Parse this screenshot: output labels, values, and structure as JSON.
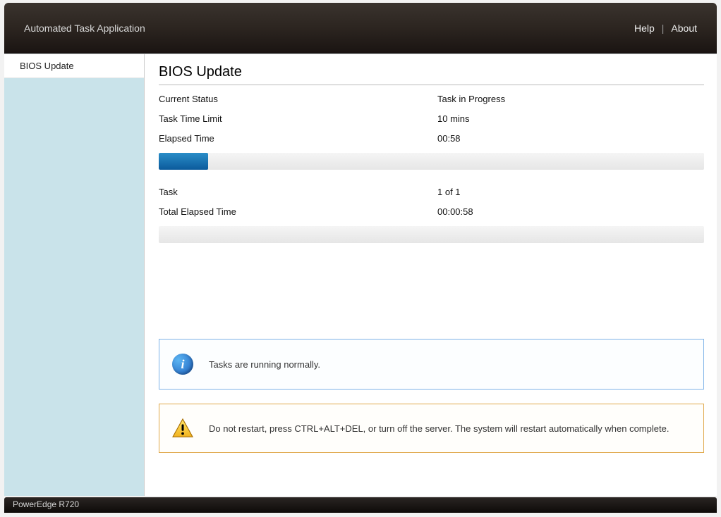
{
  "header": {
    "title": "Automated Task Application",
    "links": {
      "help": "Help",
      "about": "About"
    }
  },
  "sidebar": {
    "items": [
      {
        "label": "BIOS Update"
      }
    ]
  },
  "main": {
    "page_title": "BIOS Update",
    "status_rows": [
      {
        "label": "Current Status",
        "value": "Task in Progress"
      },
      {
        "label": "Task Time Limit",
        "value": "10 mins"
      },
      {
        "label": "Elapsed Time",
        "value": "00:58"
      }
    ],
    "progress1_percent": 9,
    "task_rows": [
      {
        "label": "Task",
        "value": "1 of 1"
      },
      {
        "label": "Total Elapsed Time",
        "value": "00:00:58"
      }
    ],
    "progress2_percent": 0,
    "alerts": {
      "info": "Tasks are running normally.",
      "warn": "Do not restart, press CTRL+ALT+DEL, or turn off the server.  The system will restart automatically when complete."
    }
  },
  "footer": {
    "model": "PowerEdge R720"
  }
}
